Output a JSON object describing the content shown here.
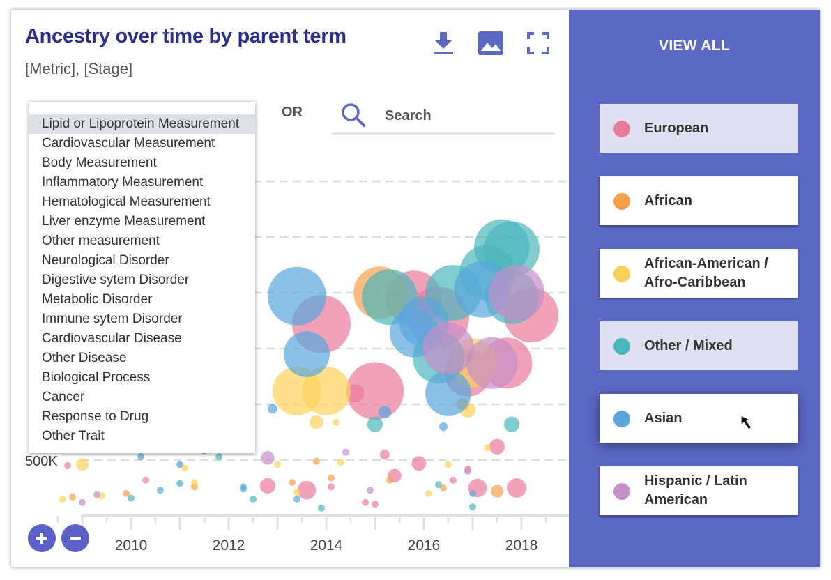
{
  "header": {
    "title": "Ancestry over time by parent term",
    "subtitle": "[Metric], [Stage]"
  },
  "toolbar": {
    "download_icon": "download-icon",
    "image_icon": "image-icon",
    "fullscreen_icon": "fullscreen-icon"
  },
  "dropdown": {
    "selected": "Lipid or Lipoprotein Measurement",
    "items": [
      "Lipid or Lipoprotein Measurement",
      "Cardiovascular Measurement",
      "Body Measurement",
      "Inflammatory Measurement",
      "Hematological Measurement",
      "Liver enzyme Measurement",
      "Other measurement",
      "Neurological Disorder",
      "Digestive sytem Disorder",
      "Metabolic Disorder",
      "Immune sytem Disorder",
      "Cardiovascular Disease",
      "Other Disease",
      "Biological Process",
      "Cancer",
      "Response to Drug",
      "Other Trait"
    ]
  },
  "filter": {
    "or_label": "OR",
    "search_placeholder": "Search"
  },
  "zoom": {
    "in_icon": "plus-icon",
    "out_icon": "minus-icon"
  },
  "legend": {
    "view_all": "VIEW ALL",
    "items": [
      {
        "label": "European",
        "color": "#e97a9a",
        "state": "dim"
      },
      {
        "label": "African",
        "color": "#f7a04b",
        "state": "normal"
      },
      {
        "label": "African-American / Afro-Caribbean",
        "color": "#fcd15b",
        "state": "normal"
      },
      {
        "label": "Other / Mixed",
        "color": "#4bb7ba",
        "state": "dim"
      },
      {
        "label": "Asian",
        "color": "#5aa6dd",
        "state": "hover"
      },
      {
        "label": "Hispanic / Latin American",
        "color": "#c58fc7",
        "state": "normal"
      }
    ]
  },
  "chart_data": {
    "type": "scatter",
    "title": "Ancestry over time by parent term",
    "xlim": [
      2008.3,
      2020
    ],
    "ylim": [
      0,
      3200000
    ],
    "x_ticks": [
      "2010",
      "2012",
      "2014",
      "2016",
      "2018"
    ],
    "y_tick_labels": [
      "500K"
    ],
    "y_gridlines": [
      500000,
      1000000,
      1500000,
      2000000,
      2500000,
      3000000
    ],
    "series": [
      {
        "name": "European",
        "color": "#e97a9a",
        "points": [
          [
            2008.7,
            450000,
            0.5
          ],
          [
            2010.3,
            320000,
            0.5
          ],
          [
            2012.8,
            270000,
            1.6
          ],
          [
            2013.6,
            230000,
            1.9
          ],
          [
            2014.1,
            260000,
            0.5
          ],
          [
            2014.8,
            120000,
            0.5
          ],
          [
            2015.0,
            105000,
            0.6
          ],
          [
            2015.4,
            360000,
            1.4
          ],
          [
            2015.2,
            550000,
            1.0
          ],
          [
            2015.9,
            470000,
            1.5
          ],
          [
            2016.6,
            320000,
            0.5
          ],
          [
            2016.9,
            420000,
            0.5
          ],
          [
            2017.1,
            250000,
            1.9
          ],
          [
            2017.5,
            620000,
            1.6
          ],
          [
            2017.9,
            250000,
            2.0
          ],
          [
            2014.6,
            1100000,
            1.8
          ],
          [
            2013.9,
            1720000,
            6.0
          ],
          [
            2015.0,
            1120000,
            5.9
          ],
          [
            2016.3,
            1780000,
            6.3
          ],
          [
            2016.9,
            1280000,
            4.8
          ],
          [
            2017.7,
            1370000,
            5.2
          ],
          [
            2018.2,
            1800000,
            5.6
          ],
          [
            2015.8,
            1950000,
            5.7
          ]
        ]
      },
      {
        "name": "African",
        "color": "#f7a04b",
        "points": [
          [
            2008.8,
            170000,
            0.3
          ],
          [
            2009.9,
            200000,
            0.3
          ],
          [
            2011.3,
            260000,
            0.3
          ],
          [
            2013.3,
            300000,
            0.3
          ],
          [
            2013.8,
            490000,
            0.4
          ],
          [
            2014.1,
            340000,
            0.4
          ],
          [
            2015.3,
            320000,
            0.4
          ],
          [
            2016.4,
            250000,
            0.5
          ],
          [
            2016.8,
            1000000,
            1.3
          ],
          [
            2017.5,
            220000,
            1.3
          ],
          [
            2015.1,
            2000000,
            5.4
          ]
        ]
      },
      {
        "name": "African-American / Afro-Caribbean",
        "color": "#fcd15b",
        "points": [
          [
            2008.6,
            150000,
            0.3
          ],
          [
            2009.0,
            460000,
            1.3
          ],
          [
            2009.4,
            180000,
            0.5
          ],
          [
            2011.1,
            430000,
            0.4
          ],
          [
            2011.3,
            300000,
            0.4
          ],
          [
            2011.6,
            850000,
            1.4
          ],
          [
            2013.0,
            460000,
            0.4
          ],
          [
            2013.4,
            210000,
            0.4
          ],
          [
            2013.8,
            840000,
            1.4
          ],
          [
            2014.2,
            840000,
            0.5
          ],
          [
            2014.3,
            480000,
            0.5
          ],
          [
            2016.1,
            200000,
            0.4
          ],
          [
            2016.9,
            950000,
            1.6
          ],
          [
            2016.5,
            460000,
            0.4
          ],
          [
            2017.3,
            610000,
            0.4
          ],
          [
            2013.4,
            1120000,
            5.0
          ],
          [
            2014.0,
            1120000,
            5.0
          ],
          [
            2017.0,
            1370000,
            5.0
          ]
        ]
      },
      {
        "name": "Other / Mixed",
        "color": "#4bb7ba",
        "points": [
          [
            2010.0,
            160000,
            0.4
          ],
          [
            2011.0,
            290000,
            0.5
          ],
          [
            2011.8,
            530000,
            0.6
          ],
          [
            2011.9,
            800000,
            1.4
          ],
          [
            2012.3,
            260000,
            0.5
          ],
          [
            2012.5,
            150000,
            0.5
          ],
          [
            2013.9,
            70000,
            0.4
          ],
          [
            2015.0,
            820000,
            1.6
          ],
          [
            2016.3,
            280000,
            0.5
          ],
          [
            2017.0,
            80000,
            0.4
          ],
          [
            2017.8,
            820000,
            1.6
          ],
          [
            2015.3,
            1960000,
            5.7
          ],
          [
            2016.6,
            2000000,
            5.7
          ],
          [
            2016.3,
            1420000,
            5.3
          ],
          [
            2017.3,
            2180000,
            5.7
          ],
          [
            2017.6,
            2410000,
            5.7
          ],
          [
            2017.8,
            2390000,
            5.7
          ],
          [
            2017.8,
            1960000,
            5.5
          ]
        ]
      },
      {
        "name": "Asian",
        "color": "#5aa6dd",
        "points": [
          [
            2010.2,
            530000,
            0.4
          ],
          [
            2010.6,
            230000,
            0.4
          ],
          [
            2011.0,
            460000,
            0.5
          ],
          [
            2011.8,
            640000,
            0.6
          ],
          [
            2012.3,
            240000,
            0.5
          ],
          [
            2012.9,
            960000,
            1.0
          ],
          [
            2013.4,
            150000,
            0.4
          ],
          [
            2015.2,
            930000,
            1.3
          ],
          [
            2016.4,
            800000,
            0.9
          ],
          [
            2017.0,
            200000,
            0.4
          ],
          [
            2013.6,
            1450000,
            4.7
          ],
          [
            2013.4,
            1970000,
            6.0
          ],
          [
            2015.8,
            1640000,
            5.0
          ],
          [
            2016.5,
            1100000,
            4.7
          ],
          [
            2017.2,
            2030000,
            5.8
          ],
          [
            2016.0,
            1740000,
            5.1
          ]
        ]
      },
      {
        "name": "Hispanic / Latin American",
        "color": "#c58fc7",
        "points": [
          [
            2009.0,
            120000,
            0.3
          ],
          [
            2009.3,
            190000,
            0.4
          ],
          [
            2011.5,
            580000,
            0.5
          ],
          [
            2012.8,
            520000,
            1.4
          ],
          [
            2014.4,
            570000,
            0.4
          ],
          [
            2014.9,
            230000,
            0.4
          ],
          [
            2016.9,
            400000,
            0.4
          ],
          [
            2017.4,
            1370000,
            5.3
          ],
          [
            2017.9,
            2000000,
            5.7
          ],
          [
            2016.5,
            1500000,
            5.3
          ]
        ]
      }
    ]
  }
}
